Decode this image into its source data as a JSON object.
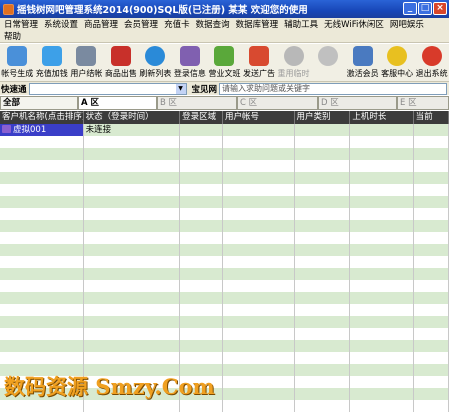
{
  "window": {
    "title": "摇钱树网吧管理系统2014(900)SQL版(已注册)   某某  欢迎您的使用"
  },
  "menu": {
    "row1": [
      "日常管理",
      "系统设置",
      "商品管理",
      "会员管理",
      "充值卡",
      "数据查询",
      "数据库管理",
      "辅助工具",
      "无线WiFi休闲区",
      "网吧娱乐"
    ],
    "row2": [
      "帮助"
    ]
  },
  "toolbar": [
    {
      "label": "帐号生成",
      "icon": "user-card-icon",
      "color": "#4a90d9",
      "disabled": false
    },
    {
      "label": "充值加钱",
      "icon": "card-coin-icon",
      "color": "#3da0e8",
      "disabled": false
    },
    {
      "label": "用户结帐",
      "icon": "calculator-icon",
      "color": "#7a8aa0",
      "disabled": false
    },
    {
      "label": "商品出售",
      "icon": "cola-can-icon",
      "color": "#c8302a",
      "disabled": false
    },
    {
      "label": "刷新列表",
      "icon": "refresh-icon",
      "color": "#2a8ad8",
      "disabled": false
    },
    {
      "label": "登录信息",
      "icon": "users-icon",
      "color": "#8060b0",
      "disabled": false
    },
    {
      "label": "营业文班",
      "icon": "person-green-icon",
      "color": "#5aa83a",
      "disabled": false
    },
    {
      "label": "发送广告",
      "icon": "megaphone-icon",
      "color": "#d84a30",
      "disabled": false
    },
    {
      "label": "重用临时",
      "icon": "disc-gray-icon",
      "color": "#b8b8b8",
      "disabled": true
    },
    {
      "label": "",
      "icon": "disc-gray-icon",
      "color": "#c0c0c0",
      "disabled": true
    },
    {
      "label": "激活会员",
      "icon": "member-icon",
      "color": "#4a7ac0",
      "disabled": false
    },
    {
      "label": "客服中心",
      "icon": "smiley-icon",
      "color": "#e8c020",
      "disabled": false
    },
    {
      "label": "退出系统",
      "icon": "power-icon",
      "color": "#d83a2a",
      "disabled": false
    }
  ],
  "quickbar": {
    "label": "快速通",
    "kb_label": "宝见网",
    "kb_placeholder": "请输入求助问题或关键字"
  },
  "area_tabs": [
    "全部",
    "A 区",
    "B 区",
    "C 区",
    "D 区",
    "E 区"
  ],
  "grid": {
    "columns": [
      "客户机名称(点击排序)",
      "状态（登录时间）",
      "登录区域",
      "用户帐号",
      "用户类别",
      "上机时长",
      "当前"
    ],
    "rows": [
      {
        "name": "虚拟001",
        "status": "未连接"
      }
    ]
  },
  "watermark": "数码资源 Smzy.Com"
}
